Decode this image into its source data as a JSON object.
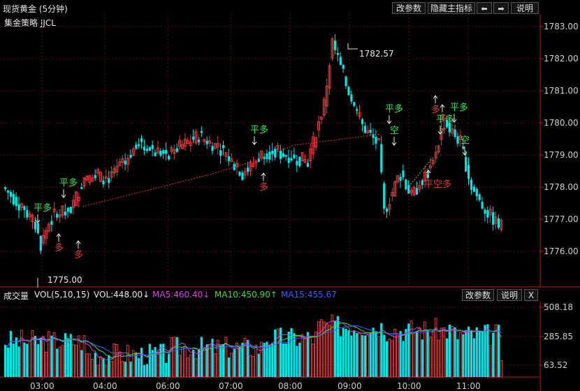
{
  "header": {
    "title": "现货黄金 (5分钟)",
    "strategy": "集金策略 JJCL",
    "buttons": {
      "params": "改参数",
      "hide": "隐藏主指标",
      "left": "⬅",
      "right": "➡",
      "help": "说明"
    }
  },
  "main_chart": {
    "yaxis_ticks": [
      "1783.00",
      "1782.00",
      "1781.00",
      "1780.00",
      "1779.00",
      "1778.00",
      "1777.00",
      "1776.00"
    ],
    "high_label": "1782.57",
    "low_label": "1775.00",
    "signals": [
      {
        "text": "平多",
        "color": "#3ee05a"
      },
      {
        "text": "多",
        "color": "#e03c3c"
      },
      {
        "text": "多",
        "color": "#e03c3c"
      },
      {
        "text": "平多",
        "color": "#3ee05a"
      },
      {
        "text": "多",
        "color": "#e03c3c"
      },
      {
        "text": "平多",
        "color": "#3ee05a"
      },
      {
        "text": "多",
        "color": "#e03c3c"
      },
      {
        "text": "平多",
        "color": "#3ee05a"
      },
      {
        "text": "空",
        "color": "#3ee05a"
      },
      {
        "text": "多",
        "color": "#e03c3c"
      },
      {
        "text": "平多",
        "color": "#3ee05a"
      },
      {
        "text": "平多",
        "color": "#3ee05a"
      },
      {
        "text": "空",
        "color": "#3ee05a"
      },
      {
        "text": "平空多",
        "color": "#e03c3c"
      }
    ]
  },
  "volume_panel": {
    "title": "成交量",
    "indicator": "VOL(5,10,15)",
    "vol": "VOL:448.00↓",
    "ma5": "MA5:460.40↓",
    "ma10": "MA10:450.90↑",
    "ma15": "MA15:455.67",
    "buttons": {
      "params": "改参数",
      "help": "说明",
      "close": "X"
    },
    "yaxis_ticks": [
      "508.18",
      "285.85",
      "63.52"
    ]
  },
  "time_axis": [
    "03:00",
    "04:00",
    "06:00",
    "07:00",
    "08:00",
    "09:00",
    "10:00",
    "11:00"
  ],
  "colors": {
    "up": "#e03c3c",
    "down": "#00e5e5",
    "ma5": "#e040e0",
    "ma10": "#44dd44",
    "ma15": "#3f5fff",
    "grid": "#5a1414",
    "title_red": "#e03c3c"
  }
}
